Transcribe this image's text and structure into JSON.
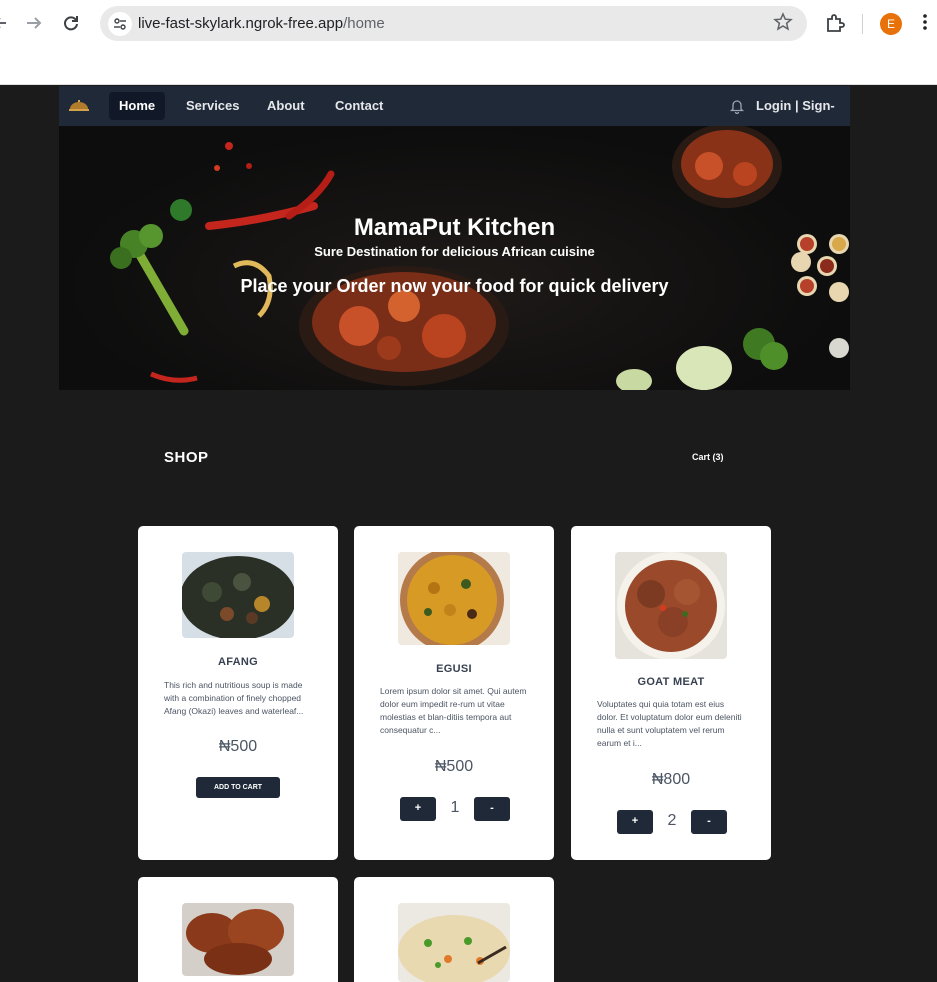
{
  "browser": {
    "url_host": "live-fast-skylark.ngrok-free.app",
    "url_path": "/home",
    "profile_initial": "E",
    "icons": [
      "back-arrow-icon",
      "forward-arrow-icon",
      "reload-icon",
      "site-settings-icon",
      "bookmark-star-icon",
      "extensions-icon",
      "more-menu-icon"
    ]
  },
  "nav": {
    "links": [
      "Home",
      "Services",
      "About",
      "Contact"
    ],
    "active": "Home",
    "login_label": "Login | Sign-up"
  },
  "hero": {
    "title": "MamaPut Kitchen",
    "subtitle": "Sure Destination for delicious African cuisine",
    "cta": "Place your Order now your food for quick delivery"
  },
  "shop": {
    "title": "SHOP",
    "cart_label": "Cart (3)"
  },
  "products": [
    {
      "name": "AFANG",
      "description": "This rich and nutritious soup is made with a combination of finely chopped Afang (Okazi) leaves and waterleaf...",
      "price": "₦500",
      "add_label": "ADD TO CART"
    },
    {
      "name": "EGUSI",
      "description": "Lorem ipsum dolor sit amet. Qui autem dolor eum impedit re-rum ut vitae molestias et blan-ditiis tempora aut consequatur c...",
      "price": "₦500",
      "qty": "1",
      "plus": "+",
      "minus": "-"
    },
    {
      "name": "GOAT MEAT",
      "description": "Voluptates qui quia totam est eius dolor. Et voluptatum dolor eum deleniti nulla et sunt voluptatem vel rerum earum et i...",
      "price": "₦800",
      "qty": "2",
      "plus": "+",
      "minus": "-"
    }
  ],
  "colors": {
    "page_bg": "#1b1b1b",
    "nav_bg": "#1f2937",
    "button_bg": "#1f2937",
    "card_bg": "#ffffff",
    "profile": "#e8710a"
  }
}
